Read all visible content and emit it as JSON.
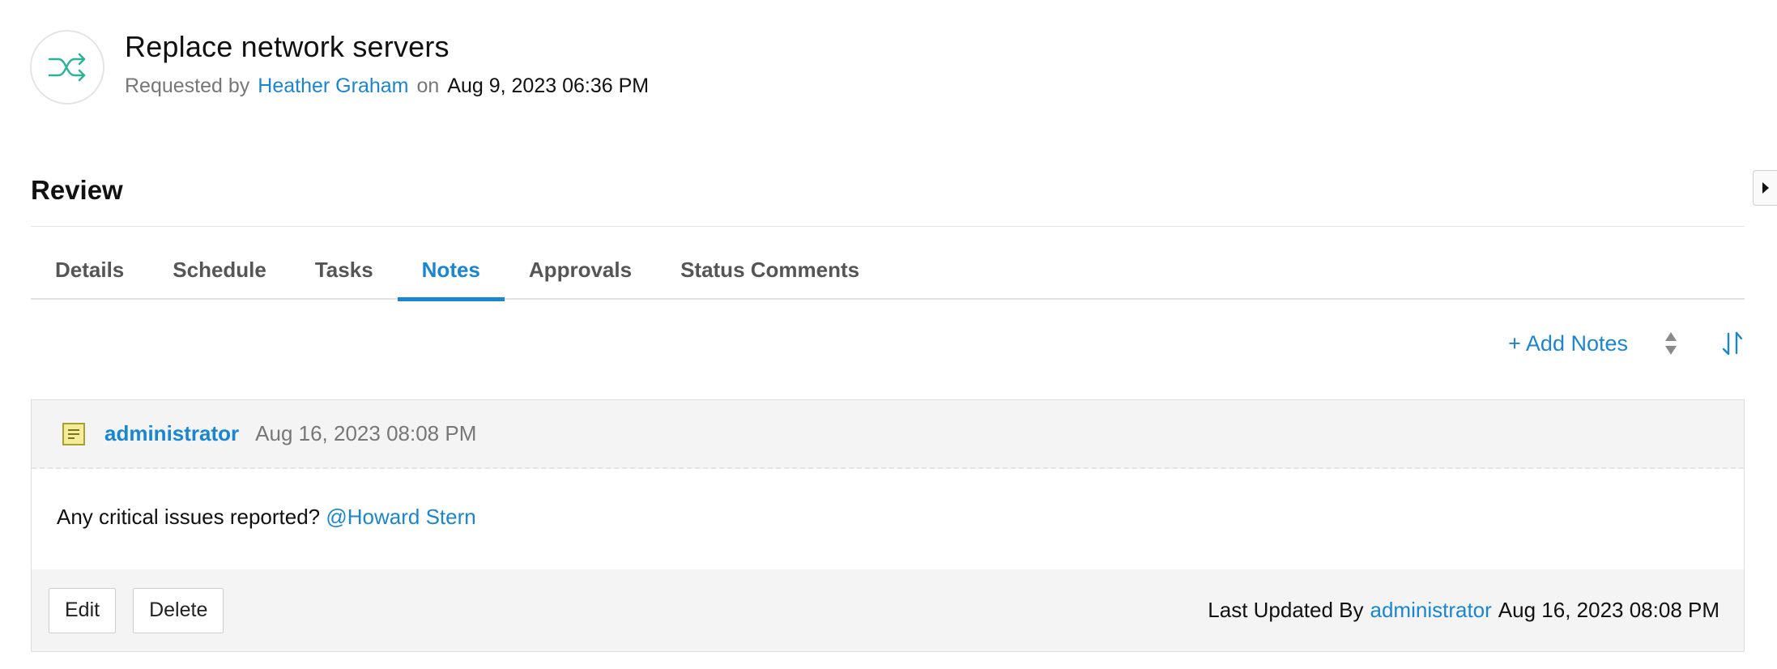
{
  "header": {
    "icon": "shuffle-icon",
    "title": "Replace network servers",
    "requested_by_label": "Requested by",
    "requester": "Heather Graham",
    "on_label": "on",
    "requested_date": "Aug 9, 2023 06:36 PM"
  },
  "section": {
    "heading": "Review"
  },
  "panel_toggle": {
    "icon": "caret-right-icon"
  },
  "tabs": [
    {
      "label": "Details",
      "active": false
    },
    {
      "label": "Schedule",
      "active": false
    },
    {
      "label": "Tasks",
      "active": false
    },
    {
      "label": "Notes",
      "active": true
    },
    {
      "label": "Approvals",
      "active": false
    },
    {
      "label": "Status Comments",
      "active": false
    }
  ],
  "toolbar": {
    "add_notes_label": "+ Add Notes",
    "sort_icon": "sort-updown-icon",
    "order_icon": "sort-order-icon"
  },
  "notes": [
    {
      "icon": "note-icon",
      "author": "administrator",
      "date": "Aug 16, 2023 08:08 PM",
      "text": "Any critical issues reported?",
      "mention": "@Howard Stern",
      "edit_label": "Edit",
      "delete_label": "Delete",
      "last_updated_label": "Last Updated By",
      "last_updated_by": "administrator",
      "last_updated_date": "Aug 16, 2023 08:08 PM"
    }
  ],
  "colors": {
    "accent": "#1a86d0",
    "icon_green": "#2bb39a",
    "note_icon_fill": "#f5ec9a"
  }
}
